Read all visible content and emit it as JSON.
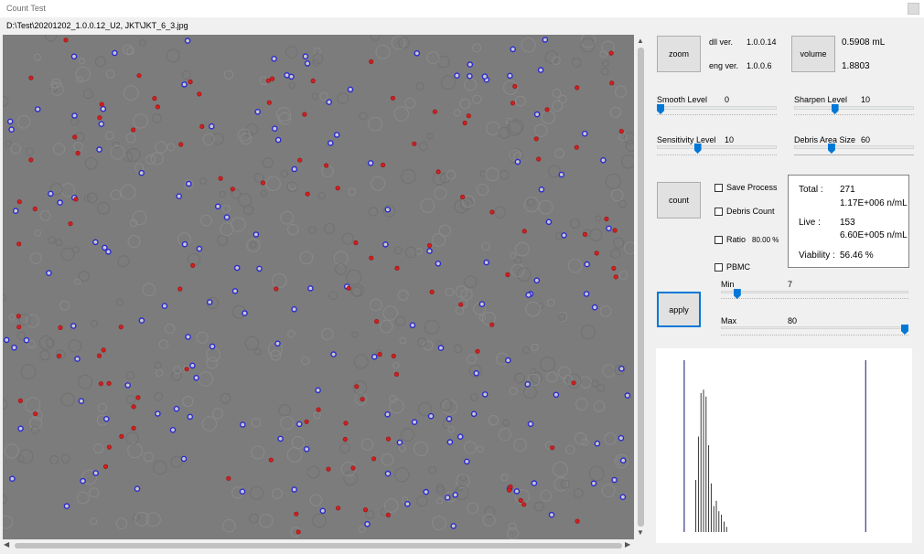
{
  "window": {
    "title": "Count Test"
  },
  "file": {
    "path": "D:\\Test\\20201202_1.0.0.12_U2, JKT\\JKT_6_3.jpg"
  },
  "buttons": {
    "zoom": "zoom",
    "volume": "volume",
    "count": "count",
    "apply": "apply"
  },
  "version": {
    "dll_label": "dll ver.",
    "dll_value": "1.0.0.14",
    "eng_label": "eng ver.",
    "eng_value": "1.0.0.6"
  },
  "volume": {
    "value": "0.5908 mL",
    "factor": "1.8803"
  },
  "sliders": {
    "smooth": {
      "label": "Smooth Level",
      "value": "0",
      "fraction": 0.0
    },
    "sharpen": {
      "label": "Sharpen Level",
      "value": "10",
      "fraction": 0.33
    },
    "sensitivity": {
      "label": "Sensitivity Level",
      "value": "10",
      "fraction": 0.33
    },
    "debris": {
      "label": "Debris Area Size",
      "value": "60",
      "fraction": 0.3
    },
    "min": {
      "label": "Min",
      "value": "7",
      "fraction": 0.07
    },
    "max": {
      "label": "Max",
      "value": "80",
      "fraction": 1.0
    }
  },
  "checkboxes": {
    "save_process": "Save Process",
    "debris_count": "Debris Count",
    "ratio": "Ratio",
    "ratio_value": "80.00 %",
    "pbmc": "PBMC"
  },
  "results": {
    "total_label": "Total :",
    "total_count": "271",
    "total_conc": "1.17E+006 n/mL",
    "live_label": "Live :",
    "live_count": "153",
    "live_conc": "6.60E+005 n/mL",
    "viability_label": "Viability :",
    "viability_value": "56.46 %"
  },
  "histogram": {
    "min_marker": 0.06,
    "max_marker": 0.86,
    "bars": [
      0.0,
      0.0,
      0.3,
      0.55,
      0.8,
      0.82,
      0.78,
      0.5,
      0.28,
      0.15,
      0.18,
      0.12,
      0.1,
      0.06,
      0.03
    ]
  },
  "colors": {
    "live": "#2a2ad0",
    "dead": "#d02020",
    "accent": "#0078d7"
  }
}
